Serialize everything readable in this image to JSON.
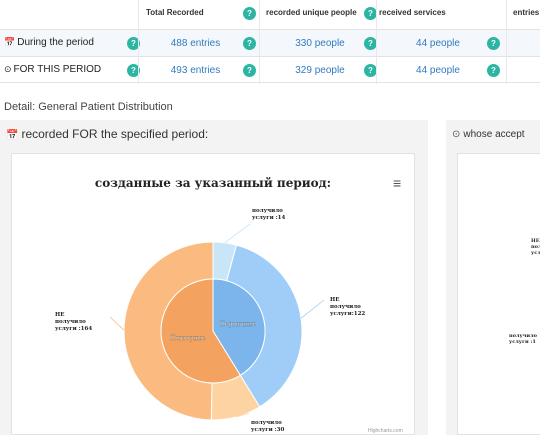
{
  "table": {
    "headers": [
      "Total Recorded",
      "recorded unique people",
      "received services",
      "entries"
    ],
    "rows": [
      {
        "label": "During the period",
        "icon": "calendar-icon",
        "values": [
          "488 entries",
          "330 people",
          "44 people"
        ]
      },
      {
        "label": "FOR THIS PERIOD",
        "icon": "clock-icon",
        "values": [
          "493 entries",
          "329 people",
          "44 people"
        ]
      }
    ],
    "help_glyph": "?"
  },
  "detail_title": "Detail: General Patient Distribution",
  "left_panel": {
    "title": "recorded FOR the specified period:",
    "icon": "calendar-icon"
  },
  "right_panel": {
    "title": "whose accept",
    "icon": "clock-icon"
  },
  "chart_menu_glyph": "≡",
  "credits": "Highcharts.com",
  "right_labels": [
    "НЕ\nпол\nуслу",
    "получило\nуслуги :1"
  ],
  "chart_data": {
    "type": "pie",
    "title": "созданные за указанный период:",
    "inner": [
      {
        "name": "Первичные",
        "value": 136,
        "color": "#7cb4ec"
      },
      {
        "name": "Повторные",
        "value": 194,
        "color": "#f3a35f"
      }
    ],
    "outer": [
      {
        "label": "получило\nуслуги :14",
        "value": 14,
        "color": "#c8e6f8"
      },
      {
        "label": "НЕ\nполучило\nуслуги:122",
        "value": 122,
        "color": "#9fcdf8"
      },
      {
        "label": "получило\nуслуги :30",
        "value": 30,
        "color": "#fdd3a1"
      },
      {
        "label": "НЕ\nполучило\nуслуги :164",
        "value": 164,
        "color": "#fbbb80"
      }
    ]
  },
  "colors": {
    "accent": "#2f7bbf",
    "help_icon": "#2cb5a3"
  }
}
